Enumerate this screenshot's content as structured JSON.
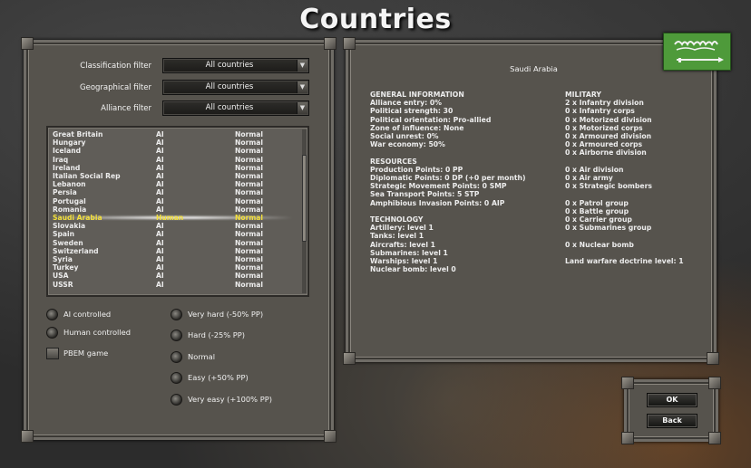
{
  "screen": {
    "title": "Countries"
  },
  "filters": {
    "classification": {
      "label": "Classification filter",
      "value": "All countries"
    },
    "geographical": {
      "label": "Geographical filter",
      "value": "All countries"
    },
    "alliance": {
      "label": "Alliance filter",
      "value": "All countries"
    }
  },
  "countries": [
    {
      "name": "Great Britain",
      "control": "AI",
      "difficulty": "Normal"
    },
    {
      "name": "Hungary",
      "control": "AI",
      "difficulty": "Normal"
    },
    {
      "name": "Iceland",
      "control": "AI",
      "difficulty": "Normal"
    },
    {
      "name": "Iraq",
      "control": "AI",
      "difficulty": "Normal"
    },
    {
      "name": "Ireland",
      "control": "AI",
      "difficulty": "Normal"
    },
    {
      "name": "Italian Social Rep",
      "control": "AI",
      "difficulty": "Normal"
    },
    {
      "name": "Lebanon",
      "control": "AI",
      "difficulty": "Normal"
    },
    {
      "name": "Persia",
      "control": "AI",
      "difficulty": "Normal"
    },
    {
      "name": "Portugal",
      "control": "AI",
      "difficulty": "Normal"
    },
    {
      "name": "Romania",
      "control": "AI",
      "difficulty": "Normal"
    },
    {
      "name": "Saudi Arabia",
      "control": "Human",
      "difficulty": "Normal"
    },
    {
      "name": "Slovakia",
      "control": "AI",
      "difficulty": "Normal"
    },
    {
      "name": "Spain",
      "control": "AI",
      "difficulty": "Normal"
    },
    {
      "name": "Sweden",
      "control": "AI",
      "difficulty": "Normal"
    },
    {
      "name": "Switzerland",
      "control": "AI",
      "difficulty": "Normal"
    },
    {
      "name": "Syria",
      "control": "AI",
      "difficulty": "Normal"
    },
    {
      "name": "Turkey",
      "control": "AI",
      "difficulty": "Normal"
    },
    {
      "name": "USA",
      "control": "AI",
      "difficulty": "Normal"
    },
    {
      "name": "USSR",
      "control": "AI",
      "difficulty": "Normal"
    }
  ],
  "selected_index": 10,
  "control_options": {
    "ai": "AI controlled",
    "human": "Human controlled",
    "pbem": "PBEM game"
  },
  "difficulty_options": [
    "Very hard (-50% PP)",
    "Hard (-25% PP)",
    "Normal",
    "Easy (+50% PP)",
    "Very easy (+100% PP)"
  ],
  "info": {
    "country": "Saudi Arabia",
    "general_lines": [
      "GENERAL INFORMATION",
      "Alliance entry: 0%",
      "Political strength: 30",
      "Political orientation: Pro-allied",
      "Zone of influence: None",
      "Social unrest: 0%",
      "War economy: 50%",
      "",
      "RESOURCES",
      "Production Points: 0 PP",
      "Diplomatic Points: 0 DP (+0 per month)",
      "Strategic Movement Points: 0 SMP",
      "Sea Transport Points: 5 STP",
      "Amphibious Invasion Points: 0 AIP",
      "",
      "TECHNOLOGY",
      "Artillery: level 1",
      "Tanks: level 1",
      "Aircrafts: level 1",
      "Submarines: level 1",
      "Warships: level 1",
      "Nuclear bomb: level 0"
    ],
    "military_lines": [
      "MILITARY",
      "2 x Infantry division",
      "0 x Infantry corps",
      "0 x Motorized division",
      "0 x Motorized corps",
      "0 x Armoured division",
      "0 x Armoured corps",
      "0 x Airborne division",
      "",
      "0 x Air division",
      "0 x Air army",
      "0 x Strategic bombers",
      "",
      "0 x Patrol group",
      "0 x Battle group",
      "0 x Carrier group",
      "0 x Submarines group",
      "",
      "0 x Nuclear bomb",
      "",
      "Land warfare doctrine level: 1"
    ]
  },
  "buttons": {
    "ok": "OK",
    "back": "Back"
  },
  "colors": {
    "selected_text": "#f3e03a",
    "flag_green": "#4e9a3a",
    "panel_bg": "#56534d"
  },
  "icons": {
    "flag": "saudi-arabia-flag",
    "dropdown": "chevron-down-icon"
  }
}
